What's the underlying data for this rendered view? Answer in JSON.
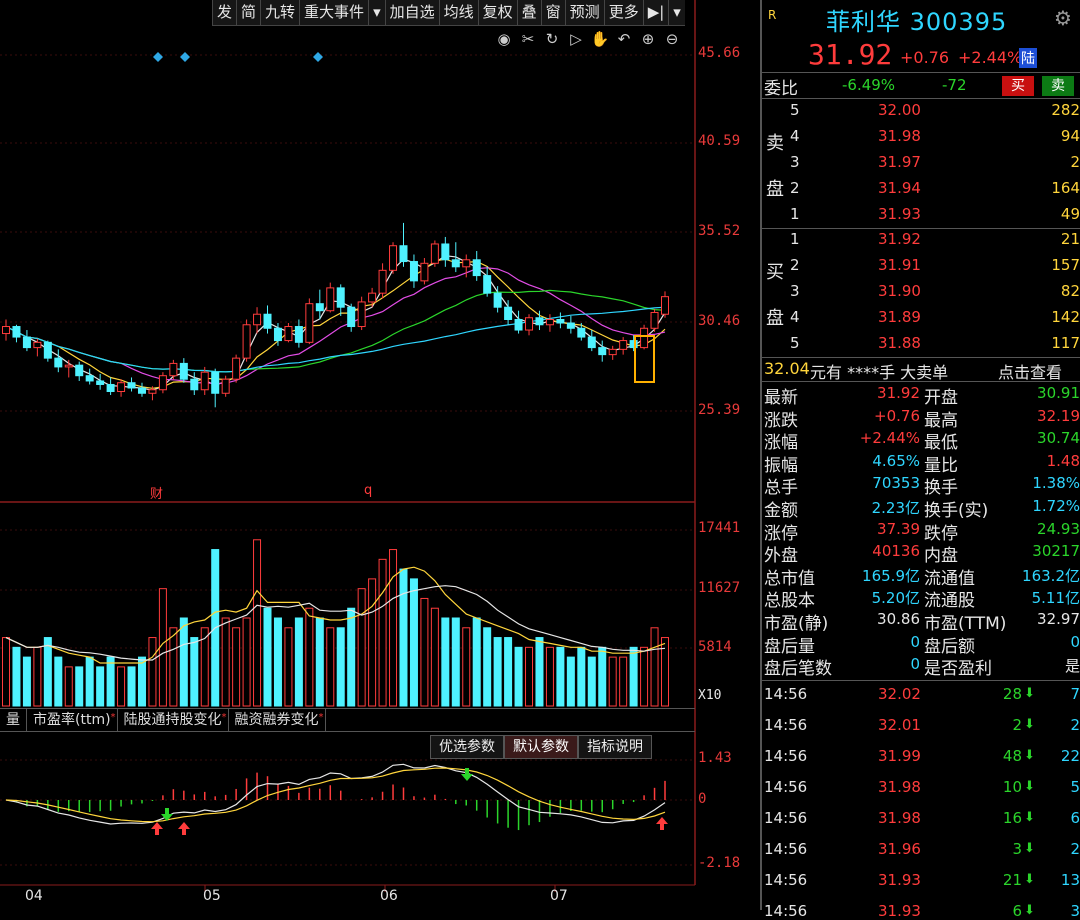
{
  "toolbar": {
    "buttons": [
      "发",
      "简",
      "九转",
      "重大事件",
      "▾",
      "加自选",
      "均线",
      "复权",
      "叠",
      "窗",
      "预测",
      "更多",
      "▶|",
      "▾"
    ]
  },
  "chart_icons": [
    "eye-icon",
    "scissors-icon",
    "cycle-icon",
    "play-icon",
    "hand-icon",
    "undo-icon",
    "zoom-in-icon",
    "zoom-out-icon"
  ],
  "chart_data": {
    "type": "candlestick",
    "price_axis": [
      "45.66",
      "40.59",
      "35.52",
      "30.46",
      "25.39"
    ],
    "volume_axis": [
      "17441",
      "11627",
      "5814"
    ],
    "volume_unit": "X10",
    "macd_axis": [
      "1.43",
      "0",
      "-2.18"
    ],
    "x_ticks": [
      "04",
      "05",
      "06",
      "07"
    ],
    "event_marks": [
      "财",
      "q"
    ],
    "candles": [
      [
        29.8,
        30.6,
        29.4,
        30.2
      ],
      [
        30.2,
        30.3,
        29.3,
        29.6
      ],
      [
        29.6,
        30.0,
        28.8,
        29.0
      ],
      [
        29.0,
        29.5,
        28.5,
        29.3
      ],
      [
        29.3,
        29.4,
        28.2,
        28.4
      ],
      [
        28.4,
        28.9,
        27.6,
        27.9
      ],
      [
        27.9,
        28.3,
        27.3,
        28.0
      ],
      [
        28.0,
        28.2,
        27.1,
        27.4
      ],
      [
        27.4,
        27.8,
        26.9,
        27.1
      ],
      [
        27.1,
        27.5,
        26.6,
        26.9
      ],
      [
        26.9,
        27.3,
        26.3,
        26.5
      ],
      [
        26.5,
        27.2,
        26.2,
        27.0
      ],
      [
        27.0,
        27.3,
        26.5,
        26.7
      ],
      [
        26.7,
        27.0,
        26.2,
        26.4
      ],
      [
        26.4,
        26.8,
        26.0,
        26.6
      ],
      [
        26.6,
        27.6,
        26.4,
        27.4
      ],
      [
        27.4,
        28.3,
        27.2,
        28.1
      ],
      [
        28.1,
        28.4,
        27.0,
        27.2
      ],
      [
        27.2,
        27.6,
        26.3,
        26.6
      ],
      [
        26.6,
        27.9,
        26.3,
        27.6
      ],
      [
        27.6,
        27.8,
        25.6,
        26.4
      ],
      [
        26.4,
        27.4,
        26.2,
        27.2
      ],
      [
        27.2,
        28.6,
        27.0,
        28.4
      ],
      [
        28.4,
        30.6,
        28.2,
        30.3
      ],
      [
        30.3,
        31.3,
        29.8,
        30.9
      ],
      [
        30.9,
        31.4,
        29.8,
        30.1
      ],
      [
        30.1,
        30.4,
        29.1,
        29.4
      ],
      [
        29.4,
        30.4,
        29.3,
        30.2
      ],
      [
        30.2,
        30.6,
        29.0,
        29.3
      ],
      [
        29.3,
        31.8,
        29.2,
        31.5
      ],
      [
        31.5,
        32.3,
        30.6,
        31.1
      ],
      [
        31.1,
        32.7,
        31.0,
        32.4
      ],
      [
        32.4,
        32.6,
        30.8,
        31.3
      ],
      [
        31.3,
        31.5,
        29.9,
        30.2
      ],
      [
        30.2,
        31.9,
        30.0,
        31.6
      ],
      [
        31.6,
        32.4,
        31.3,
        32.1
      ],
      [
        32.1,
        33.8,
        31.8,
        33.4
      ],
      [
        33.4,
        35.0,
        33.2,
        34.8
      ],
      [
        34.8,
        36.1,
        33.6,
        33.9
      ],
      [
        33.9,
        34.3,
        32.4,
        32.8
      ],
      [
        32.8,
        34.1,
        32.6,
        33.8
      ],
      [
        33.8,
        35.1,
        33.6,
        34.9
      ],
      [
        34.9,
        35.3,
        33.6,
        34.0
      ],
      [
        34.0,
        35.0,
        33.3,
        33.6
      ],
      [
        33.6,
        34.3,
        33.0,
        34.0
      ],
      [
        34.0,
        34.5,
        32.8,
        33.1
      ],
      [
        33.1,
        33.6,
        31.9,
        32.1
      ],
      [
        32.1,
        32.5,
        31.0,
        31.3
      ],
      [
        31.3,
        31.7,
        30.3,
        30.6
      ],
      [
        30.6,
        31.1,
        29.8,
        30.0
      ],
      [
        30.0,
        30.9,
        29.7,
        30.7
      ],
      [
        30.7,
        31.1,
        30.0,
        30.3
      ],
      [
        30.3,
        30.9,
        29.9,
        30.6
      ],
      [
        30.6,
        31.0,
        30.1,
        30.4
      ],
      [
        30.4,
        30.8,
        29.8,
        30.1
      ],
      [
        30.1,
        30.4,
        29.4,
        29.6
      ],
      [
        29.6,
        30.0,
        28.8,
        29.0
      ],
      [
        29.0,
        29.4,
        28.2,
        28.6
      ],
      [
        28.6,
        29.1,
        28.3,
        28.9
      ],
      [
        28.9,
        29.6,
        28.6,
        29.4
      ],
      [
        29.4,
        29.7,
        28.8,
        29.0
      ],
      [
        29.0,
        30.3,
        28.9,
        30.1
      ],
      [
        30.1,
        31.2,
        29.9,
        31.0
      ],
      [
        30.9,
        32.2,
        30.7,
        31.9
      ]
    ],
    "volumes": [
      7,
      6,
      5,
      6,
      7,
      5,
      4,
      4,
      5,
      4,
      5,
      4,
      4,
      5,
      7,
      12,
      8,
      9,
      7,
      8,
      16,
      9,
      8,
      9,
      17,
      10,
      9,
      8,
      9,
      10,
      9,
      8,
      8,
      10,
      12,
      13,
      15,
      16,
      14,
      13,
      11,
      10,
      9,
      9,
      8,
      9,
      8,
      7,
      7,
      6,
      6,
      7,
      6,
      6,
      5,
      6,
      5,
      6,
      5,
      5,
      6,
      6,
      8,
      7
    ],
    "ma_levels": {
      "white": true,
      "yellow": true,
      "magenta": true,
      "green": true,
      "cyan": true
    }
  },
  "panel": {
    "badge": "R",
    "name": "菲利华 300395",
    "price": "31.92",
    "change": "+0.76",
    "pct": "+2.44%",
    "tag": "陆",
    "weibi_label": "委比",
    "weibi_pct": "-6.49%",
    "weibi_diff": "-72",
    "buy_btn": "买",
    "sell_btn": "卖",
    "sell_side_label": [
      "卖",
      "盘"
    ],
    "buy_side_label": [
      "买",
      "盘"
    ],
    "asks": [
      {
        "lv": "5",
        "price": "32.00",
        "vol": "282"
      },
      {
        "lv": "4",
        "price": "31.98",
        "vol": "94"
      },
      {
        "lv": "3",
        "price": "31.97",
        "vol": "2"
      },
      {
        "lv": "2",
        "price": "31.94",
        "vol": "164"
      },
      {
        "lv": "1",
        "price": "31.93",
        "vol": "49"
      }
    ],
    "bids": [
      {
        "lv": "1",
        "price": "31.92",
        "vol": "21"
      },
      {
        "lv": "2",
        "price": "31.91",
        "vol": "157"
      },
      {
        "lv": "3",
        "price": "31.90",
        "vol": "82"
      },
      {
        "lv": "4",
        "price": "31.89",
        "vol": "142"
      },
      {
        "lv": "5",
        "price": "31.88",
        "vol": "117"
      }
    ],
    "bigorder": {
      "price": "32.04",
      "mid": "元有 ****手 大卖单",
      "link": "点击查看"
    },
    "stats": [
      [
        "最新",
        "31.92",
        "red",
        "开盘",
        "30.91",
        "grn"
      ],
      [
        "涨跌",
        "+0.76",
        "red",
        "最高",
        "32.19",
        "red"
      ],
      [
        "涨幅",
        "+2.44%",
        "red",
        "最低",
        "30.74",
        "grn"
      ],
      [
        "振幅",
        "4.65%",
        "cyn",
        "量比",
        "1.48",
        "red"
      ],
      [
        "总手",
        "70353",
        "cyn",
        "换手",
        "1.38%",
        "cyn"
      ],
      [
        "金额",
        "2.23亿",
        "cyn",
        "换手(实)",
        "1.72%",
        "cyn"
      ],
      [
        "涨停",
        "37.39",
        "red",
        "跌停",
        "24.93",
        "grn"
      ],
      [
        "外盘",
        "40136",
        "red",
        "内盘",
        "30217",
        "grn"
      ],
      [
        "总市值",
        "165.9亿",
        "cyn",
        "流通值",
        "163.2亿",
        "cyn"
      ],
      [
        "总股本",
        "5.20亿",
        "cyn",
        "流通股",
        "5.11亿",
        "cyn"
      ],
      [
        "市盈(静)",
        "30.86",
        "wht",
        "市盈(TTM)",
        "32.97",
        "wht"
      ],
      [
        "盘后量",
        "0",
        "cyn",
        "盘后额",
        "0",
        "cyn"
      ],
      [
        "盘后笔数",
        "0",
        "cyn",
        "是否盈利",
        "是",
        "wht"
      ]
    ],
    "ticks": [
      {
        "t": "14:56",
        "p": "32.02",
        "v": "28",
        "n": "7"
      },
      {
        "t": "14:56",
        "p": "32.01",
        "v": "2",
        "n": "2"
      },
      {
        "t": "14:56",
        "p": "31.99",
        "v": "48",
        "n": "22"
      },
      {
        "t": "14:56",
        "p": "31.98",
        "v": "10",
        "n": "5"
      },
      {
        "t": "14:56",
        "p": "31.98",
        "v": "16",
        "n": "6"
      },
      {
        "t": "14:56",
        "p": "31.96",
        "v": "3",
        "n": "2"
      },
      {
        "t": "14:56",
        "p": "31.93",
        "v": "21",
        "n": "13"
      },
      {
        "t": "14:56",
        "p": "31.93",
        "v": "6",
        "n": "3"
      }
    ]
  },
  "tabs": [
    "量",
    "市盈率(ttm)",
    "陆股通持股变化",
    "融资融券变化"
  ],
  "param_buttons": [
    "优选参数",
    "默认参数",
    "指标说明"
  ]
}
